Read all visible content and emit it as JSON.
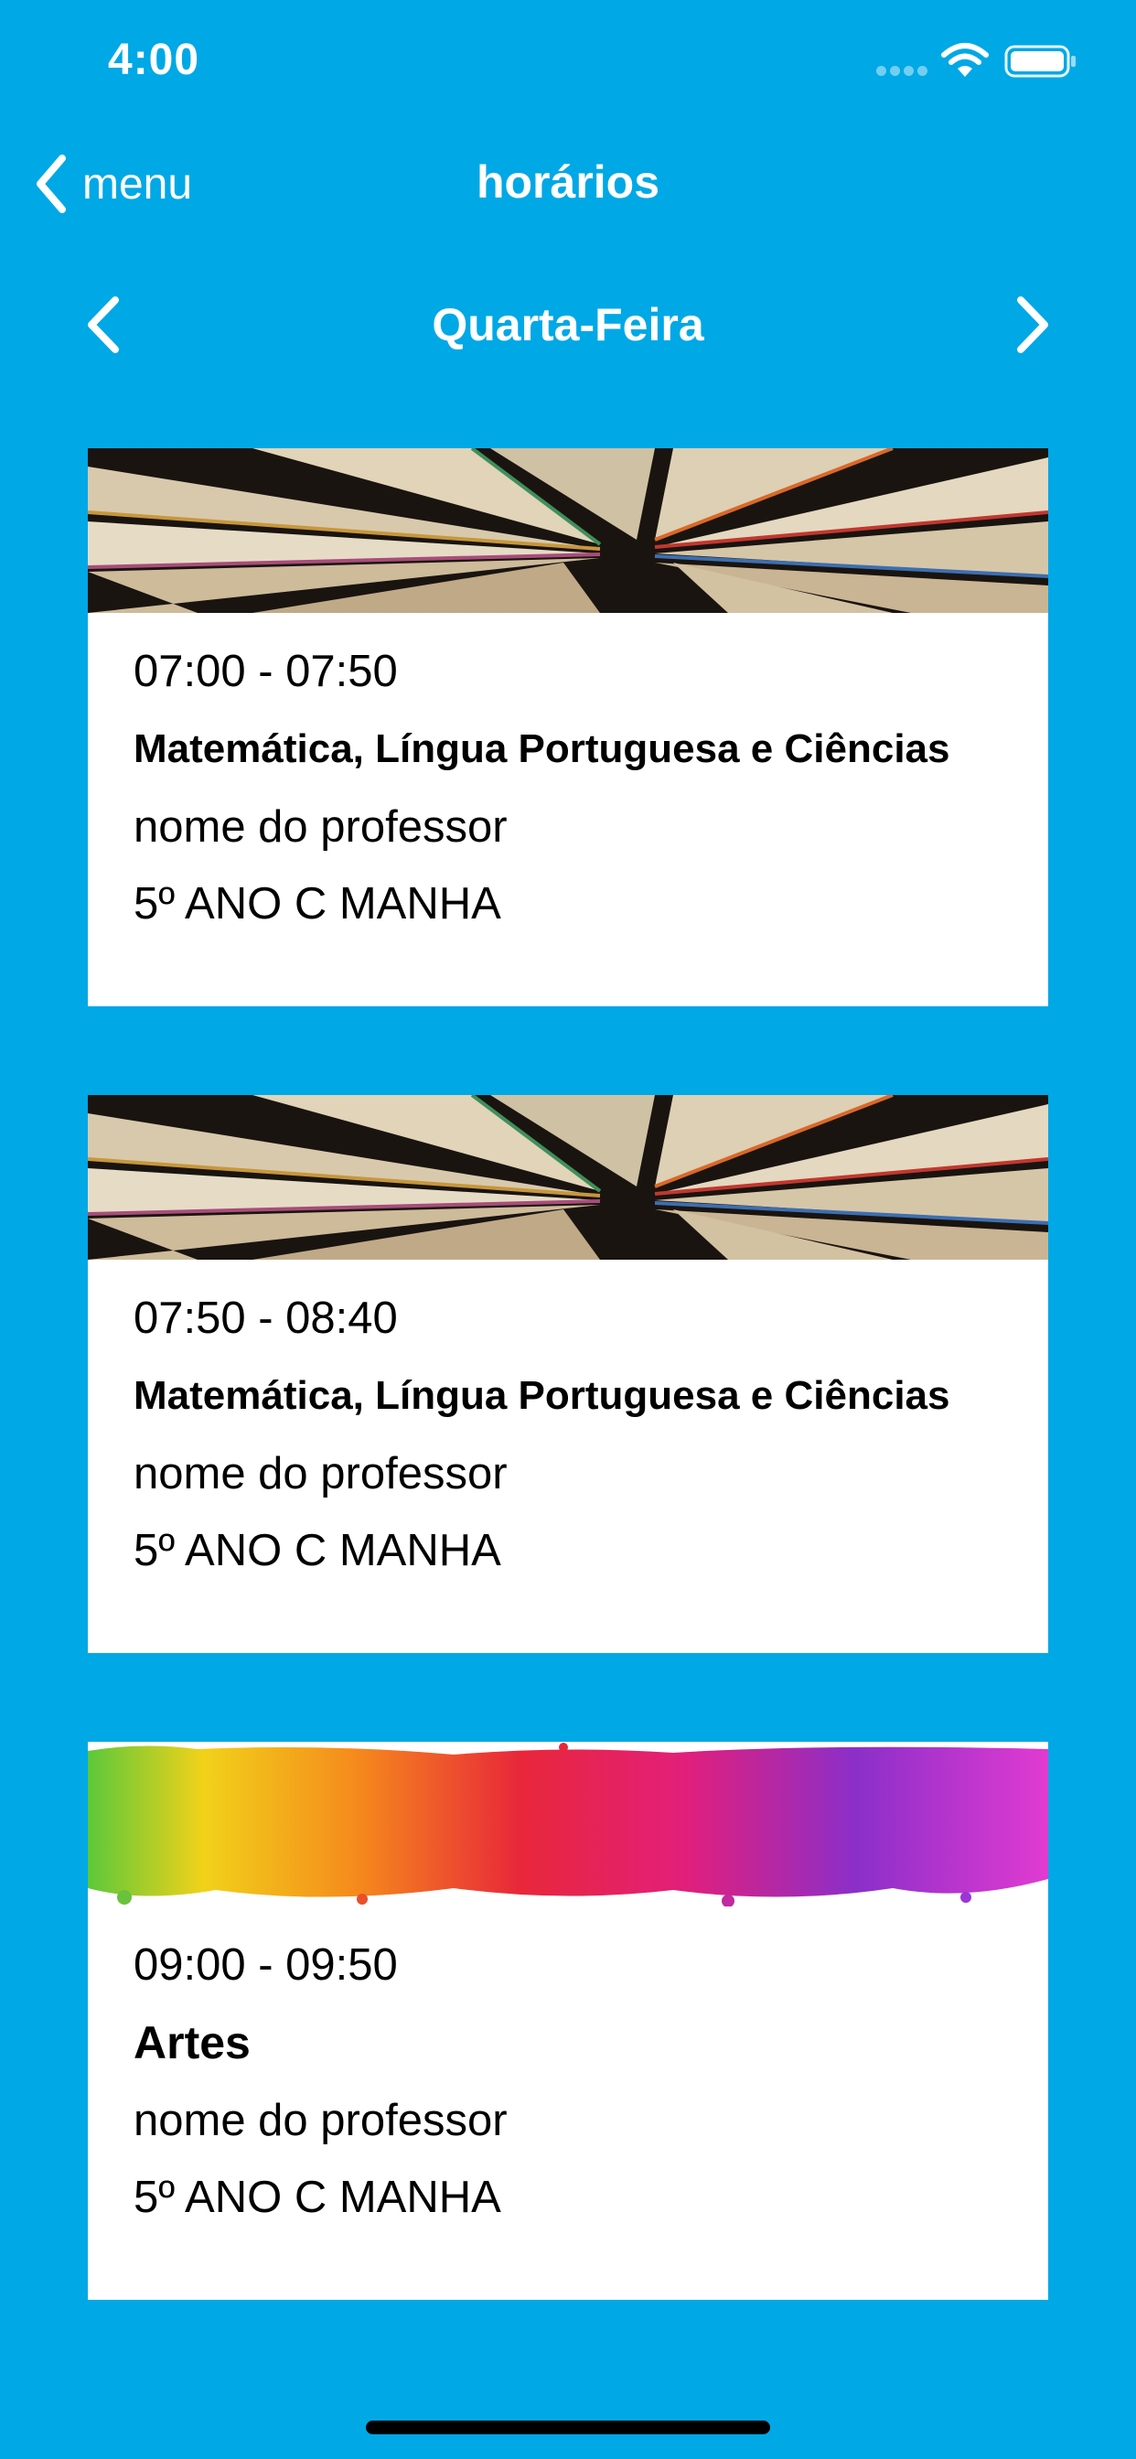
{
  "status_bar": {
    "time": "4:00"
  },
  "nav": {
    "back_label": "menu",
    "title": "horários"
  },
  "day_selector": {
    "day": "Quarta-Feira"
  },
  "classes": [
    {
      "time": "07:00 - 07:50",
      "subject": "Matemática, Língua Portuguesa e Ciências",
      "teacher": "nome do professor",
      "class_group": "5º ANO C MANHA",
      "image": "books-image"
    },
    {
      "time": "07:50 - 08:40",
      "subject": "Matemática, Língua Portuguesa e Ciências",
      "teacher": "nome do professor",
      "class_group": "5º ANO C MANHA",
      "image": "books-image"
    },
    {
      "time": "09:00 - 09:50",
      "subject": "Artes",
      "teacher": "nome do professor",
      "class_group": "5º ANO C MANHA",
      "image": "paint-splash-image"
    }
  ],
  "colors": {
    "background": "#00A8E6",
    "card": "#FFFFFF",
    "text_light": "#FFFFFF",
    "text_dark": "#000000"
  }
}
